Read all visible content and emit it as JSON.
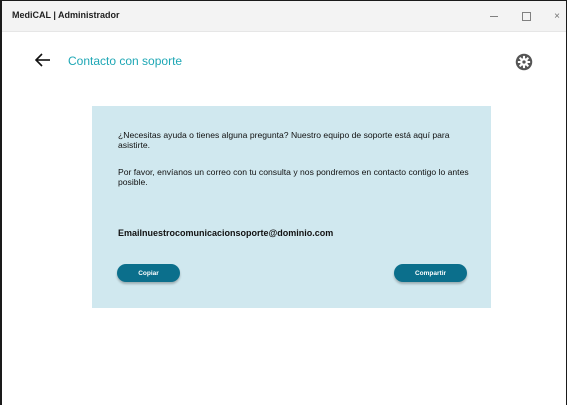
{
  "window": {
    "title": "MediCAL | Administrador",
    "controls": {
      "minimize": "minimize-icon",
      "maximize": "maximize-icon",
      "close": "×"
    }
  },
  "header": {
    "back_icon": "arrow-left-icon",
    "title": "Contacto con soporte",
    "settings_icon": "gear-icon"
  },
  "card": {
    "paragraph_1": "¿Necesitas ayuda o tienes alguna pregunta? Nuestro equipo de soporte está aquí para asistirte.",
    "paragraph_2": "Por favor, envíanos un correo con tu consulta y nos pondremos en contacto contigo lo antes posible.",
    "email_text": "Emailnuestrocomunicacionsoporte@dominio.com",
    "copy_label": "Copiar",
    "share_label": "Compartir"
  },
  "colors": {
    "accent": "#1ea7b5",
    "card_background": "#d0e8ef",
    "button_background": "#0b6f8c",
    "titlebar": "#f3f3f3"
  }
}
